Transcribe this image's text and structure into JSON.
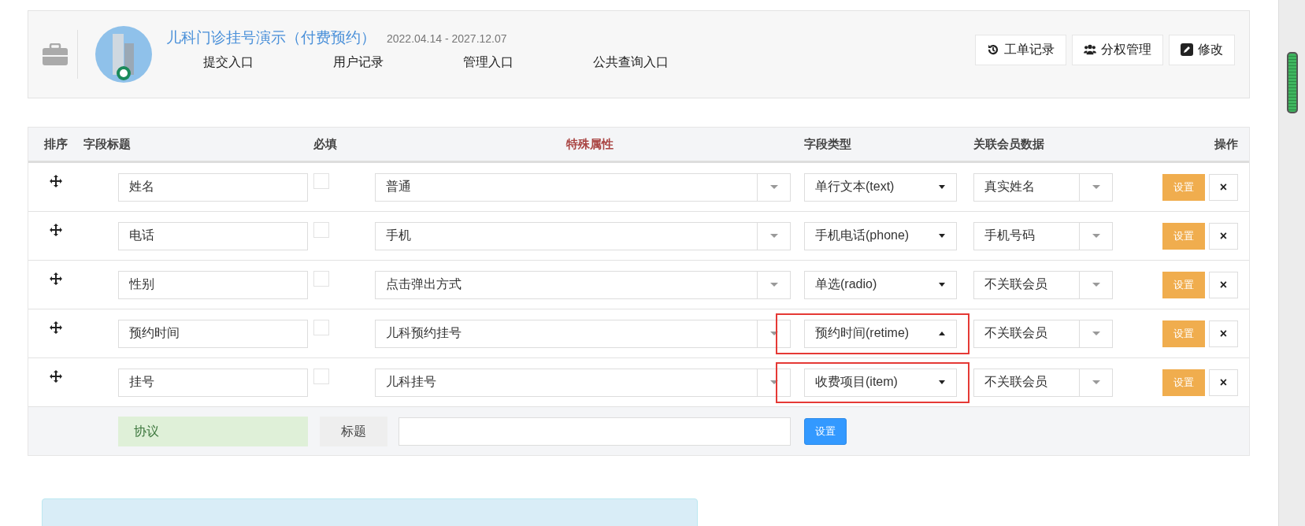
{
  "header": {
    "title": "儿科门诊挂号演示（付费预约）",
    "date_range": "2022.04.14 - 2027.12.07",
    "links": [
      "提交入口",
      "用户记录",
      "管理入口",
      "公共查询入口"
    ],
    "buttons": [
      {
        "kind": "history",
        "label": "工单记录"
      },
      {
        "kind": "users",
        "label": "分权管理"
      },
      {
        "kind": "edit",
        "label": "修改"
      }
    ]
  },
  "table": {
    "columns": [
      {
        "label": "排序",
        "kind": "plain"
      },
      {
        "label": "字段标题",
        "kind": "plain"
      },
      {
        "label": "必填",
        "kind": "plain"
      },
      {
        "label": "特殊属性",
        "kind": "accent"
      },
      {
        "label": "字段类型",
        "kind": "plain"
      },
      {
        "label": "关联会员数据",
        "kind": "plain"
      },
      {
        "label": "操作",
        "kind": "right"
      }
    ],
    "rows": [
      {
        "title": "姓名",
        "required": false,
        "attribute": "普通",
        "type": "单行文本(text)",
        "type_expanded": false,
        "highlighted": false,
        "member": "真实姓名",
        "set_label": "设置",
        "delete_label": "×"
      },
      {
        "title": "电话",
        "required": false,
        "attribute": "手机",
        "type": "手机电话(phone)",
        "type_expanded": false,
        "highlighted": false,
        "member": "手机号码",
        "set_label": "设置",
        "delete_label": "×"
      },
      {
        "title": "性别",
        "required": false,
        "attribute": "点击弹出方式",
        "type": "单选(radio)",
        "type_expanded": false,
        "highlighted": false,
        "member": "不关联会员",
        "set_label": "设置",
        "delete_label": "×"
      },
      {
        "title": "预约时间",
        "required": false,
        "attribute": "儿科预约挂号",
        "type": "预约时间(retime)",
        "type_expanded": true,
        "highlighted": true,
        "member": "不关联会员",
        "set_label": "设置",
        "delete_label": "×"
      },
      {
        "title": "挂号",
        "required": false,
        "attribute": "儿科挂号",
        "type": "收费项目(item)",
        "type_expanded": false,
        "highlighted": true,
        "member": "不关联会员",
        "set_label": "设置",
        "delete_label": "×"
      }
    ],
    "footer": {
      "agreement": "协议",
      "title_label": "标题",
      "button": "设置"
    }
  }
}
